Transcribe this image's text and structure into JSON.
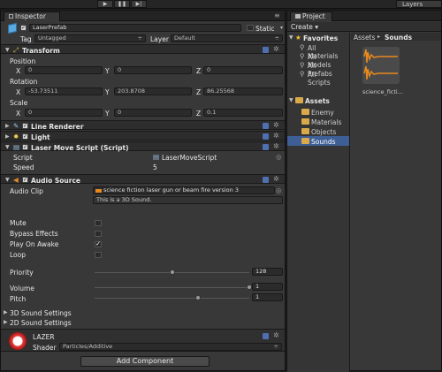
{
  "toolbar": {
    "layers_label": "Layers",
    "play_icon": "▶",
    "pause_icon": "❚❚",
    "step_icon": "▶|"
  },
  "inspector": {
    "tab_label": "Inspector",
    "object_name": "LaserPrefab",
    "static_label": "Static",
    "tag_label": "Tag",
    "tag_value": "Untagged",
    "layer_label": "Layer",
    "layer_value": "Default",
    "transform": {
      "title": "Transform",
      "position_label": "Position",
      "rotation_label": "Rotation",
      "scale_label": "Scale",
      "x": "X",
      "y": "Y",
      "z": "Z",
      "position": {
        "x": "0",
        "y": "0",
        "z": "0"
      },
      "rotation": {
        "x": "-53.73511",
        "y": "203.8708",
        "z": "86.25568"
      },
      "scale": {
        "x": "0",
        "y": "0",
        "z": "0.1"
      }
    },
    "line_renderer": {
      "title": "Line Renderer"
    },
    "light": {
      "title": "Light"
    },
    "laser_script": {
      "title": "Laser Move Script (Script)",
      "script_label": "Script",
      "script_value": "LaserMoveScript",
      "speed_label": "Speed",
      "speed_value": "5"
    },
    "audio": {
      "title": "Audio Source",
      "clip_label": "Audio Clip",
      "clip_value": "science fiction laser gun or beam fire version 3",
      "clip_note": "This is a 3D Sound.",
      "mute_label": "Mute",
      "mute_checked": false,
      "bypass_label": "Bypass Effects",
      "bypass_checked": false,
      "play_on_awake_label": "Play On Awake",
      "play_on_awake_checked": true,
      "loop_label": "Loop",
      "loop_checked": false,
      "priority_label": "Priority",
      "priority_value": "128",
      "priority_level": 0.5,
      "volume_label": "Volume",
      "volume_value": "1",
      "volume_level": 1,
      "pitch_label": "Pitch",
      "pitch_value": "1",
      "pitch_level": 0.67,
      "sound3d_label": "3D Sound Settings",
      "sound2d_label": "2D Sound Settings"
    },
    "material": {
      "name": "LAZER",
      "shader_label": "Shader",
      "shader_value": "Particles/Additive"
    },
    "add_component_label": "Add Component",
    "check_glyph": "✓"
  },
  "project": {
    "tab_label": "Project",
    "create_label": "Create ▾",
    "favorites_label": "Favorites",
    "favorites": [
      "All Materials",
      "All Models",
      "All Prefabs",
      "All Scripts"
    ],
    "assets_label": "Assets",
    "folders": [
      "Enemy",
      "Materials",
      "Objects",
      "Sounds"
    ],
    "selected_folder": "Sounds",
    "breadcrumb": {
      "root": "Assets",
      "separator": "▸",
      "current": "Sounds"
    },
    "asset_name": "science_ficti..."
  },
  "colors": {
    "accent": "#3e5f96",
    "waveform": "#e8891e",
    "folder": "#d9a94a",
    "material": "#d42020"
  }
}
